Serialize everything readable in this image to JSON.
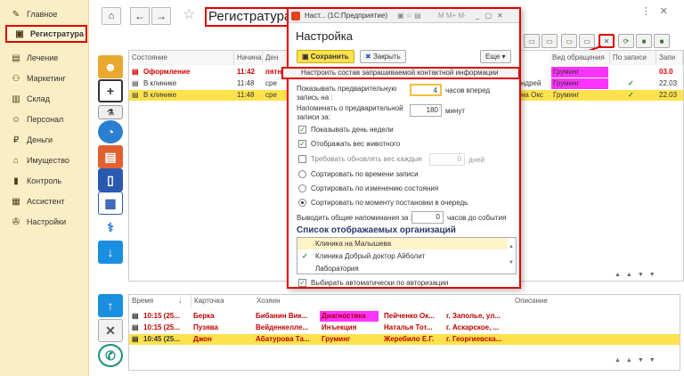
{
  "sidebar": {
    "items": [
      {
        "label": "Главное",
        "icon": "pencil-icon"
      },
      {
        "label": "Регистратура",
        "icon": "clipboard-icon"
      },
      {
        "label": "Лечение",
        "icon": "treatment-icon"
      },
      {
        "label": "Маркетинг",
        "icon": "marketing-icon"
      },
      {
        "label": "Склад",
        "icon": "warehouse-icon"
      },
      {
        "label": "Персонал",
        "icon": "staff-icon"
      },
      {
        "label": "Деньги",
        "icon": "money-icon"
      },
      {
        "label": "Имущество",
        "icon": "property-icon"
      },
      {
        "label": "Контроль",
        "icon": "control-icon"
      },
      {
        "label": "Ассистент",
        "icon": "assistant-icon"
      },
      {
        "label": "Настройки",
        "icon": "wrench-icon"
      }
    ]
  },
  "header": {
    "title": "Регистратура"
  },
  "top_table": {
    "headers": [
      "Состояние",
      "Начиная с",
      "Ден",
      "Вид обращения",
      "По записи",
      "Запи"
    ],
    "rows": [
      {
        "state": "Оформление",
        "time": "11:42",
        "day": "пятн",
        "right1": "",
        "kind": "Груминг",
        "by_record": "",
        "rec": "03.0"
      },
      {
        "state": "В клинике",
        "time": "11:48",
        "day": "сре",
        "right1": "ндрей",
        "kind": "Груминг",
        "by_record": "✓",
        "rec": "22.03"
      },
      {
        "state": "В клинике",
        "time": "11:48",
        "day": "сре",
        "right1": "на Окс",
        "kind": "Груминг",
        "by_record": "✓",
        "rec": "22.03"
      }
    ]
  },
  "bottom_table": {
    "headers": [
      "Время",
      "Карточка",
      "Хозяин",
      "Описание"
    ],
    "rows": [
      {
        "time": "10:15 (25...",
        "card": "Берка",
        "owner": "Бибанин Вик...",
        "kind": "Диагностика",
        "doctor": "Пейченко Ок...",
        "address": "г. Заполье, ул..."
      },
      {
        "time": "10:15 (25...",
        "card": "Пузява",
        "owner": "Вейденкелле...",
        "kind": "Инъекция",
        "doctor": "Наталья Тот...",
        "address": "г. Аскарское, ..."
      },
      {
        "time": "10:45 (25...",
        "card": "Джон",
        "owner": "Абатурова Та...",
        "kind": "Груминг",
        "doctor": "Жеребило Е.Г.",
        "address": "г. Георгиевска..."
      }
    ]
  },
  "dialog": {
    "window_title": "Наст... (1С:Предприятие)",
    "title_icons": "M M+ M-",
    "heading": "Настройка",
    "save_label": "Сохранить",
    "close_label": "Закрыть",
    "more_label": "Еще",
    "contact_link": "Настроить состав запрашиваемой контактной информации",
    "show_before_label": "Показывать предварительную запись на :",
    "show_before_value": "4",
    "show_before_unit": "часов вперед",
    "remind_label": "Напоминать о предварительной записи за:",
    "remind_value": "180",
    "remind_unit": "минут",
    "checks": [
      {
        "label": "Показывать день недели",
        "checked": true
      },
      {
        "label": "Отображать вес животного",
        "checked": true
      },
      {
        "label": "Требовать обновлять вес каждые",
        "checked": false,
        "value": "0",
        "unit": "дней"
      }
    ],
    "radios": [
      {
        "label": "Сортировать по времени записи",
        "on": false
      },
      {
        "label": "Сортировать по изменению состояния",
        "on": false
      },
      {
        "label": "Сортировать по моменту постановки в очередь",
        "on": true
      }
    ],
    "reminders_label": "Выводить общие напоминания за :",
    "reminders_value": "0",
    "reminders_unit": "часов до события",
    "org_list_title": "Список отображаемых организаций",
    "orgs": [
      {
        "name": "Клиника на Малышева",
        "checked": false
      },
      {
        "name": "Клиника Добрый доктор Айболит",
        "checked": true
      },
      {
        "name": "Лаборатория",
        "checked": false
      }
    ],
    "auto_select_label": "Выбирать автоматически по авторизации"
  },
  "colors": {
    "accent_red": "#e00000",
    "sidebar_bg": "#fbedc4",
    "highlight_yellow": "#ffe24d",
    "magenta": "#ff33ff"
  }
}
